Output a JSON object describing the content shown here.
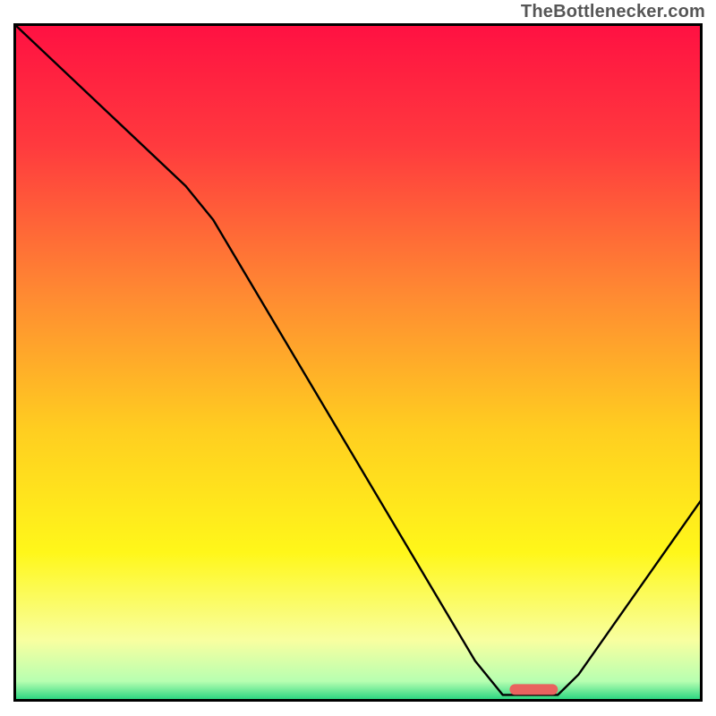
{
  "watermark": "TheBottlenecker.com",
  "chart_data": {
    "type": "line",
    "title": "",
    "xlabel": "",
    "ylabel": "",
    "xlim": [
      0,
      100
    ],
    "ylim": [
      0,
      100
    ],
    "axes_visible": false,
    "background_gradient": {
      "stops": [
        {
          "pos": 0.0,
          "color": "#ff1042"
        },
        {
          "pos": 0.18,
          "color": "#ff3a3e"
        },
        {
          "pos": 0.4,
          "color": "#ff8a32"
        },
        {
          "pos": 0.6,
          "color": "#ffce20"
        },
        {
          "pos": 0.78,
          "color": "#fff71a"
        },
        {
          "pos": 0.91,
          "color": "#f8ffa0"
        },
        {
          "pos": 0.97,
          "color": "#b7ffb1"
        },
        {
          "pos": 1.0,
          "color": "#18d07a"
        }
      ]
    },
    "series": [
      {
        "name": "bottleneck-curve",
        "color": "#000000",
        "points": [
          {
            "x": 0,
            "y": 100
          },
          {
            "x": 25,
            "y": 76
          },
          {
            "x": 29,
            "y": 71
          },
          {
            "x": 67,
            "y": 6
          },
          {
            "x": 71,
            "y": 1
          },
          {
            "x": 79,
            "y": 1
          },
          {
            "x": 82,
            "y": 4
          },
          {
            "x": 100,
            "y": 30
          }
        ]
      }
    ],
    "marker": {
      "name": "optimal-range",
      "shape": "capsule",
      "color": "#e9635f",
      "x_start": 72,
      "x_end": 79,
      "y": 1.8
    },
    "border": {
      "color": "#000000",
      "width": 3
    }
  }
}
